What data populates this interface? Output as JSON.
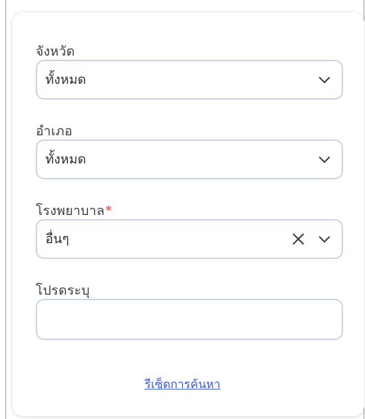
{
  "form": {
    "province": {
      "label": "จังหวัด",
      "value": "ทั้งหมด"
    },
    "district": {
      "label": "อำเภอ",
      "value": "ทั้งหมด"
    },
    "hospital": {
      "label": "โรงพยาบาล",
      "required_mark": "*",
      "value": "อื่นๆ"
    },
    "specify": {
      "label": "โปรดระบุ",
      "value": ""
    },
    "reset_label": "รีเซ็ตการค้นหา"
  },
  "colors": {
    "border": "#c7d4ea",
    "link": "#3b5bdb",
    "required": "#e53935",
    "text": "#3d3d3d"
  },
  "icons": [
    "chevron-down-icon",
    "close-icon"
  ]
}
